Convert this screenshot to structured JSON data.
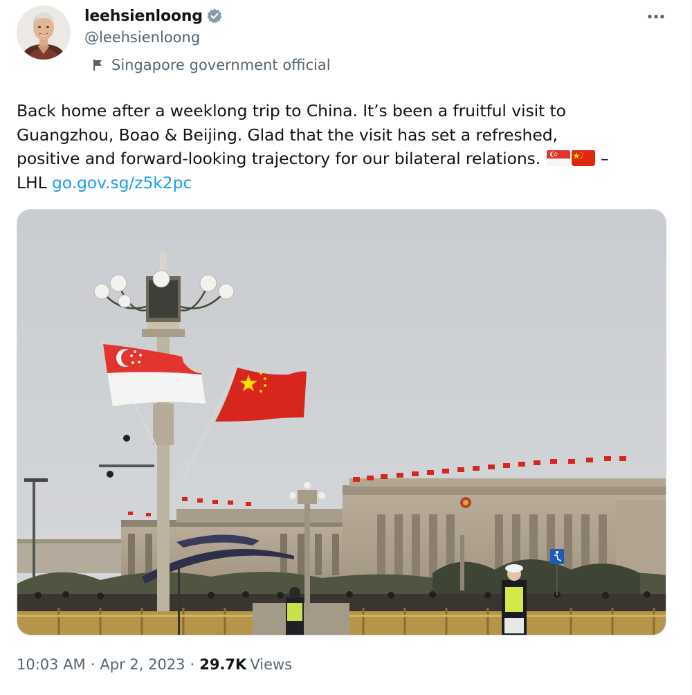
{
  "author": {
    "display_name": "leehsienloong",
    "handle": "@leehsienloong",
    "affiliation": "Singapore government official",
    "verified": true
  },
  "tweet": {
    "text_line1": "Back home after a weeklong trip to China. It’s been a fruitful visit to",
    "text_line2": "Guangzhou, Boao & Beijing. Glad that the visit has set a refreshed,",
    "text_line3": "positive and forward-looking trajectory for our bilateral relations.",
    "dash": "–",
    "text_signature": "LHL",
    "link_text": "go.gov.sg/z5k2pc",
    "emojis": [
      "singapore-flag",
      "china-flag"
    ]
  },
  "media": {
    "type": "photo",
    "subject": "Singapore and China flags on lamp post near Great Hall of the People"
  },
  "footer": {
    "time": "10:03 AM",
    "separator": "·",
    "date": "Apr 2, 2023",
    "views_count": "29.7K",
    "views_label": "Views"
  },
  "colors": {
    "link": "#1d9bf0",
    "secondary_text": "#536471",
    "verified": "#829aab",
    "singapore_red": "#e3342f",
    "china_red": "#de2910",
    "china_star": "#ffde00"
  },
  "icons": {
    "more": "more-horizontal-icon",
    "verified": "verified-badge-icon",
    "affiliation": "flag-icon"
  }
}
